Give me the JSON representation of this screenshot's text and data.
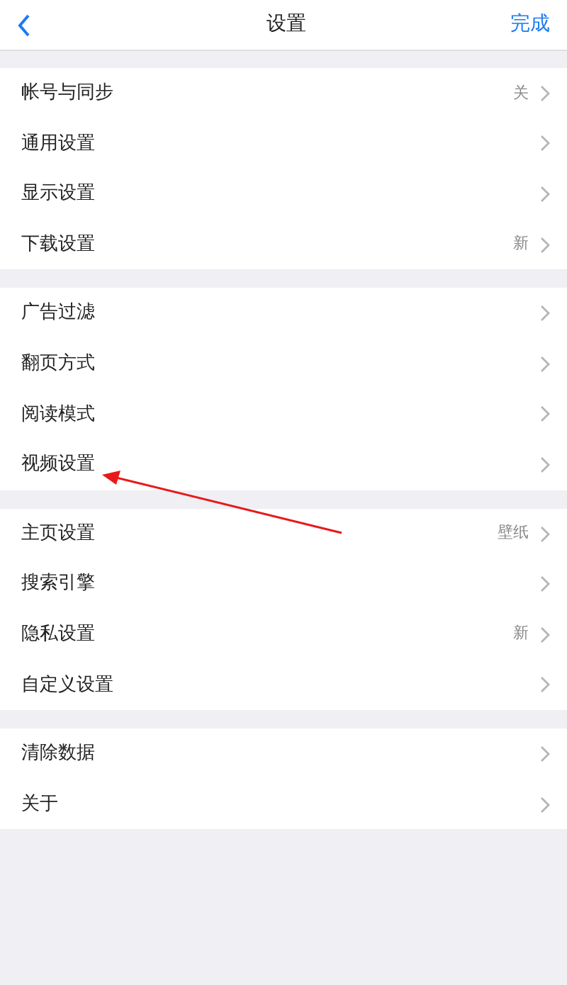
{
  "header": {
    "title": "设置",
    "done": "完成"
  },
  "groups": [
    {
      "items": [
        {
          "label": "帐号与同步",
          "value": "关"
        },
        {
          "label": "通用设置"
        },
        {
          "label": "显示设置"
        },
        {
          "label": "下载设置",
          "value": "新"
        }
      ]
    },
    {
      "items": [
        {
          "label": "广告过滤"
        },
        {
          "label": "翻页方式"
        },
        {
          "label": "阅读模式"
        },
        {
          "label": "视频设置"
        }
      ]
    },
    {
      "items": [
        {
          "label": "主页设置",
          "value": "壁纸"
        },
        {
          "label": "搜索引擎"
        },
        {
          "label": "隐私设置",
          "value": "新"
        },
        {
          "label": "自定义设置"
        }
      ]
    },
    {
      "items": [
        {
          "label": "清除数据"
        },
        {
          "label": "关于"
        }
      ]
    }
  ]
}
